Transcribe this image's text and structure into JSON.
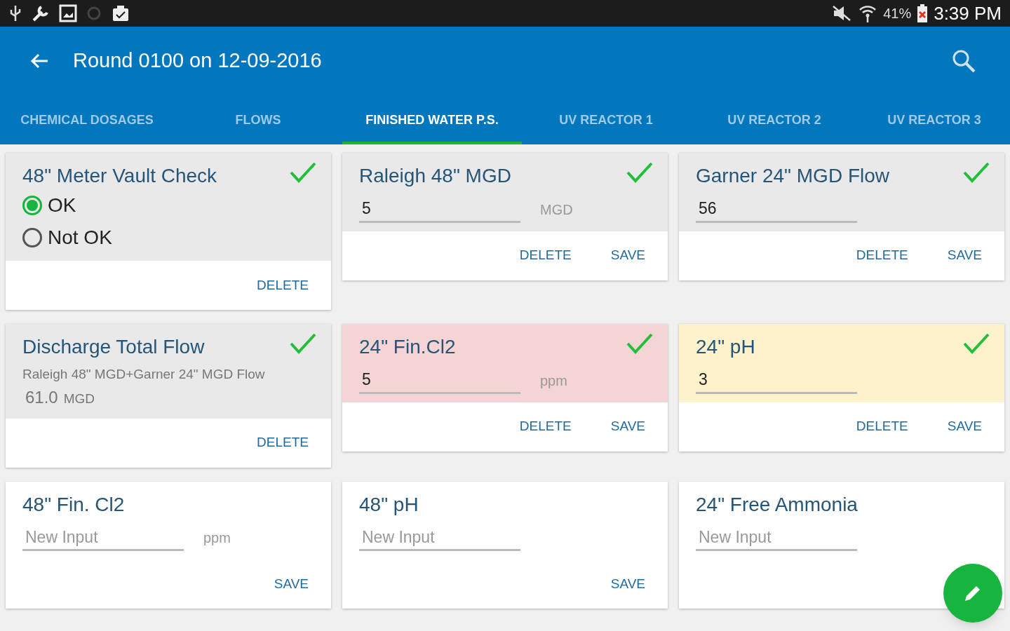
{
  "status_bar": {
    "battery": "41%",
    "time": "3:39 PM"
  },
  "app_bar": {
    "title": "Round 0100 on 12-09-2016"
  },
  "tabs": [
    {
      "label": "CHEMICAL DOSAGES",
      "selected": false
    },
    {
      "label": "FLOWS",
      "selected": false
    },
    {
      "label": "FINISHED WATER P.S.",
      "selected": true
    },
    {
      "label": "UV REACTOR 1",
      "selected": false
    },
    {
      "label": "UV REACTOR 2",
      "selected": false
    },
    {
      "label": "UV REACTOR 3",
      "selected": false
    }
  ],
  "cards": [
    {
      "kind": "radio",
      "title": "48\" Meter Vault Check",
      "checked": true,
      "color": "#e9e9e9",
      "options": [
        {
          "label": "OK",
          "selected": true
        },
        {
          "label": "Not OK",
          "selected": false
        }
      ],
      "buttons": [
        "DELETE"
      ]
    },
    {
      "kind": "input",
      "title": "Raleigh 48\" MGD",
      "checked": true,
      "color": "#e9e9e9",
      "value": "5",
      "unit": "MGD",
      "buttons": [
        "DELETE",
        "SAVE"
      ]
    },
    {
      "kind": "input",
      "title": "Garner 24\" MGD Flow",
      "checked": true,
      "color": "#e9e9e9",
      "value": "56",
      "buttons": [
        "DELETE",
        "SAVE"
      ]
    },
    {
      "kind": "formula",
      "title": "Discharge Total Flow",
      "checked": true,
      "color": "#e9e9e9",
      "formula": "Raleigh 48\" MGD+Garner 24\" MGD Flow",
      "value": "61.0",
      "unit": "MGD",
      "buttons": [
        "DELETE"
      ]
    },
    {
      "kind": "input",
      "title": "24\" Fin.Cl2",
      "checked": true,
      "color": "#f4d4d4",
      "value": "5",
      "unit": "ppm",
      "buttons": [
        "DELETE",
        "SAVE"
      ]
    },
    {
      "kind": "input",
      "title": "24\" pH",
      "checked": true,
      "color": "#fdf2cc",
      "value": "3",
      "buttons": [
        "DELETE",
        "SAVE"
      ]
    },
    {
      "kind": "input",
      "title": "48\" Fin. Cl2",
      "checked": false,
      "color": "#ffffff",
      "placeholder": "New Input",
      "unit": "ppm",
      "buttons": [
        "SAVE"
      ]
    },
    {
      "kind": "input",
      "title": "48\" pH",
      "checked": false,
      "color": "#ffffff",
      "placeholder": "New Input",
      "buttons": [
        "SAVE"
      ]
    },
    {
      "kind": "input",
      "title": "24\" Free Ammonia",
      "checked": false,
      "color": "#ffffff",
      "placeholder": "New Input"
    }
  ]
}
